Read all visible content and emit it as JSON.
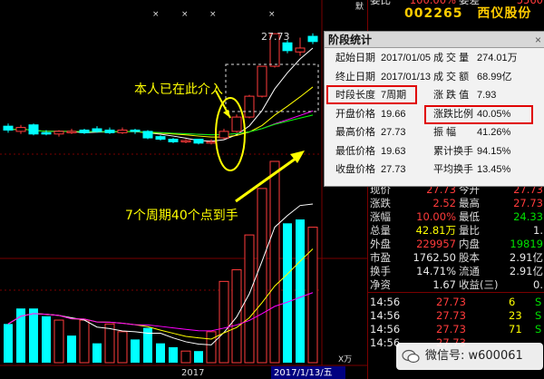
{
  "stock": {
    "code": "002265",
    "name": "西仪股份"
  },
  "partial_top": {
    "left_label": "委比",
    "left_value": "100.00%",
    "right_label": "委差",
    "right_value": "5560"
  },
  "quote_rows": [
    {
      "k1": "现价",
      "v1": "27.73",
      "c1": "red",
      "k2": "今开",
      "v2": "27.73",
      "c2": "red"
    },
    {
      "k1": "涨跌",
      "v1": "2.52",
      "c1": "red",
      "k2": "最高",
      "v2": "27.73",
      "c2": "red"
    },
    {
      "k1": "涨幅",
      "v1": "10.00%",
      "c1": "red",
      "k2": "最低",
      "v2": "24.33",
      "c2": "grn"
    },
    {
      "k1": "总量",
      "v1": "42.81万",
      "c1": "yel",
      "k2": "量比",
      "v2": "1.",
      "c2": "wht"
    },
    {
      "k1": "外盘",
      "v1": "229957",
      "c1": "red",
      "k2": "内盘",
      "v2": "19819",
      "c2": "grn"
    },
    {
      "k1": "市盈",
      "v1": "1762.50",
      "c1": "wht",
      "k2": "股本",
      "v2": "2.91亿",
      "c2": "wht"
    },
    {
      "k1": "换手",
      "v1": "14.71%",
      "c1": "wht",
      "k2": "流通",
      "v2": "2.91亿",
      "c2": "wht"
    },
    {
      "k1": "净资",
      "v1": "1.67",
      "c1": "wht",
      "k2": "收益(三)",
      "v2": "0.",
      "c2": "wht"
    }
  ],
  "ticks": [
    {
      "time": "14:56",
      "price": "27.73",
      "vol": "6",
      "flag": "S"
    },
    {
      "time": "14:56",
      "price": "27.73",
      "vol": "23",
      "flag": "S"
    },
    {
      "time": "14:56",
      "price": "27.73",
      "vol": "71",
      "flag": "S"
    },
    {
      "time": "14:56",
      "price": "27.73",
      "vol": "",
      "flag": ""
    }
  ],
  "popup": {
    "title": "阶段统计",
    "close": "×",
    "left": [
      {
        "label": "起始日期",
        "value": "2017/01/05"
      },
      {
        "label": "终止日期",
        "value": "2017/01/13"
      },
      {
        "label": "时段长度",
        "value": "7周期"
      },
      {
        "label": "开盘价格",
        "value": "19.66"
      },
      {
        "label": "最高价格",
        "value": "27.73"
      },
      {
        "label": "最低价格",
        "value": "19.63"
      },
      {
        "label": "收盘价格",
        "value": "27.73"
      }
    ],
    "right": [
      {
        "label": "成 交 量",
        "value": "274.01万"
      },
      {
        "label": "成 交 额",
        "value": "68.99亿"
      },
      {
        "label": "涨 跌 值",
        "value": "7.93"
      },
      {
        "label": "涨跌比例",
        "value": "40.05%"
      },
      {
        "label": "振    幅",
        "value": "41.26%"
      },
      {
        "label": "累计换手",
        "value": "94.15%"
      },
      {
        "label": "平均换手",
        "value": "13.45%"
      }
    ]
  },
  "annotations": {
    "entry": "本人已在此介入",
    "summary": "7个周期40个点到手"
  },
  "chart_labels": {
    "high_price": "27.73",
    "year": "2017",
    "date_box": "2017/1/13/五",
    "vol_unit": "X万",
    "top_right_mark": "默"
  },
  "watermark": {
    "text": "微信号: w600061"
  },
  "colors": {
    "up": "#ff3b3b",
    "down": "#00ffff",
    "ma5": "#ffffff",
    "ma10": "#ffff00",
    "ma20": "#ff00ff",
    "ma60": "#00ff00",
    "accent": "#ffff00"
  },
  "kline": [
    {
      "o": 20.6,
      "c": 20.3,
      "h": 20.8,
      "l": 20.1
    },
    {
      "o": 20.2,
      "c": 20.5,
      "h": 20.7,
      "l": 20.0
    },
    {
      "o": 20.7,
      "c": 20.0,
      "h": 20.8,
      "l": 19.9
    },
    {
      "o": 20.1,
      "c": 20.0,
      "h": 20.3,
      "l": 19.9
    },
    {
      "o": 20.0,
      "c": 20.2,
      "h": 20.3,
      "l": 19.8
    },
    {
      "o": 20.2,
      "c": 20.2,
      "h": 20.4,
      "l": 20.0
    },
    {
      "o": 20.3,
      "c": 20.1,
      "h": 20.4,
      "l": 20.0
    },
    {
      "o": 20.4,
      "c": 20.2,
      "h": 20.6,
      "l": 20.1
    },
    {
      "o": 20.3,
      "c": 20.1,
      "h": 20.5,
      "l": 20.0
    },
    {
      "o": 20.1,
      "c": 20.3,
      "h": 20.5,
      "l": 20.0
    },
    {
      "o": 20.3,
      "c": 20.2,
      "h": 20.4,
      "l": 20.0
    },
    {
      "o": 20.2,
      "c": 19.7,
      "h": 20.3,
      "l": 19.6
    },
    {
      "o": 19.8,
      "c": 19.6,
      "h": 19.9,
      "l": 19.5
    },
    {
      "o": 19.6,
      "c": 19.4,
      "h": 19.7,
      "l": 19.3
    },
    {
      "o": 19.5,
      "c": 19.5,
      "h": 19.6,
      "l": 19.3
    },
    {
      "o": 19.6,
      "c": 19.3,
      "h": 19.6,
      "l": 19.2
    },
    {
      "o": 19.3,
      "c": 19.4,
      "h": 19.6,
      "l": 19.2
    },
    {
      "o": 19.7,
      "c": 20.2,
      "h": 20.4,
      "l": 19.6
    },
    {
      "o": 20.2,
      "c": 21.3,
      "h": 21.5,
      "l": 20.1
    },
    {
      "o": 21.3,
      "c": 22.9,
      "h": 23.0,
      "l": 21.2
    },
    {
      "o": 22.9,
      "c": 25.2,
      "h": 25.2,
      "l": 22.8
    },
    {
      "o": 25.2,
      "c": 27.7,
      "h": 27.73,
      "l": 25.1
    },
    {
      "o": 27.0,
      "c": 26.4,
      "h": 27.2,
      "l": 26.2
    },
    {
      "o": 26.3,
      "c": 26.6,
      "h": 27.4,
      "l": 26.0
    },
    {
      "o": 27.5,
      "c": 27.1,
      "h": 27.73,
      "l": 26.9
    }
  ],
  "volume": [
    50,
    70,
    70,
    60,
    55,
    35,
    55,
    25,
    50,
    40,
    30,
    45,
    25,
    20,
    15,
    15,
    40,
    105,
    120,
    165,
    225,
    260,
    180,
    185,
    175
  ],
  "vol_colors": [
    "c",
    "c",
    "c",
    "c",
    "r",
    "c",
    "r",
    "c",
    "r",
    "r",
    "c",
    "c",
    "c",
    "c",
    "r",
    "c",
    "r",
    "r",
    "r",
    "r",
    "r",
    "r",
    "c",
    "c",
    "r"
  ]
}
